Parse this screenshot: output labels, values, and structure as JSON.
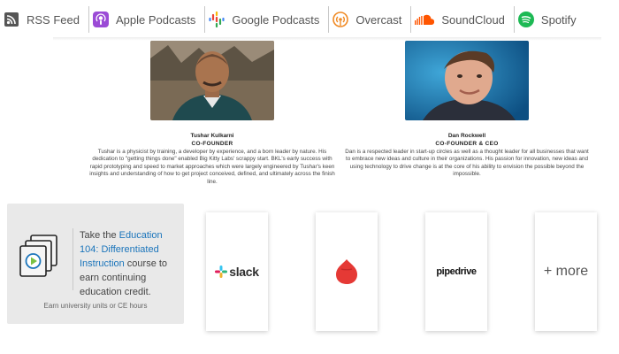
{
  "podcast_bar": {
    "items": [
      {
        "label": "RSS Feed",
        "icon": "rss-icon",
        "color": "#555555"
      },
      {
        "label": "Apple Podcasts",
        "icon": "apple-podcasts-icon",
        "color": "#9b4bd6"
      },
      {
        "label": "Google Podcasts",
        "icon": "google-podcasts-icon",
        "color": "#4285f4"
      },
      {
        "label": "Overcast",
        "icon": "overcast-icon",
        "color": "#f08a24"
      },
      {
        "label": "SoundCloud",
        "icon": "soundcloud-icon",
        "color": "#ff5500"
      },
      {
        "label": "Spotify",
        "icon": "spotify-icon",
        "color": "#1db954"
      }
    ]
  },
  "founders": [
    {
      "name": "Tushar Kulkarni",
      "role": "CO-FOUNDER",
      "bio": "Tushar is a physicist by training, a developer by experience, and a born leader by nature. His dedication to \"getting things done\" enabled Big Kitty Labs' scrappy start. BKL's early success with rapid prototyping and speed to market approaches which were largely engineered by Tushar's keen insights and understanding of how to get project conceived, defined, and ultimately across the finish line."
    },
    {
      "name": "Dan Rockwell",
      "role": "CO-FOUNDER & CEO",
      "bio": "Dan is a respected leader in start-up circles as well as a thought leader for all businesses that want to embrace new ideas and culture in their organizations. His passion for innovation, new ideas and using technology to drive change is at the core of his ability to envision the possible beyond the impossible."
    }
  ],
  "education": {
    "text_before": "Take the ",
    "link_text": "Education 104: Differentiated Instruction",
    "text_after": " course to earn continuing education credit.",
    "footer": "Earn university units or CE hours",
    "link_color": "#1b75bb"
  },
  "integrations": [
    {
      "name": "slack",
      "label": "slack"
    },
    {
      "name": "red-app",
      "label": ""
    },
    {
      "name": "pipedrive",
      "label": "pipedrive"
    },
    {
      "name": "more",
      "label": "+ more"
    }
  ]
}
